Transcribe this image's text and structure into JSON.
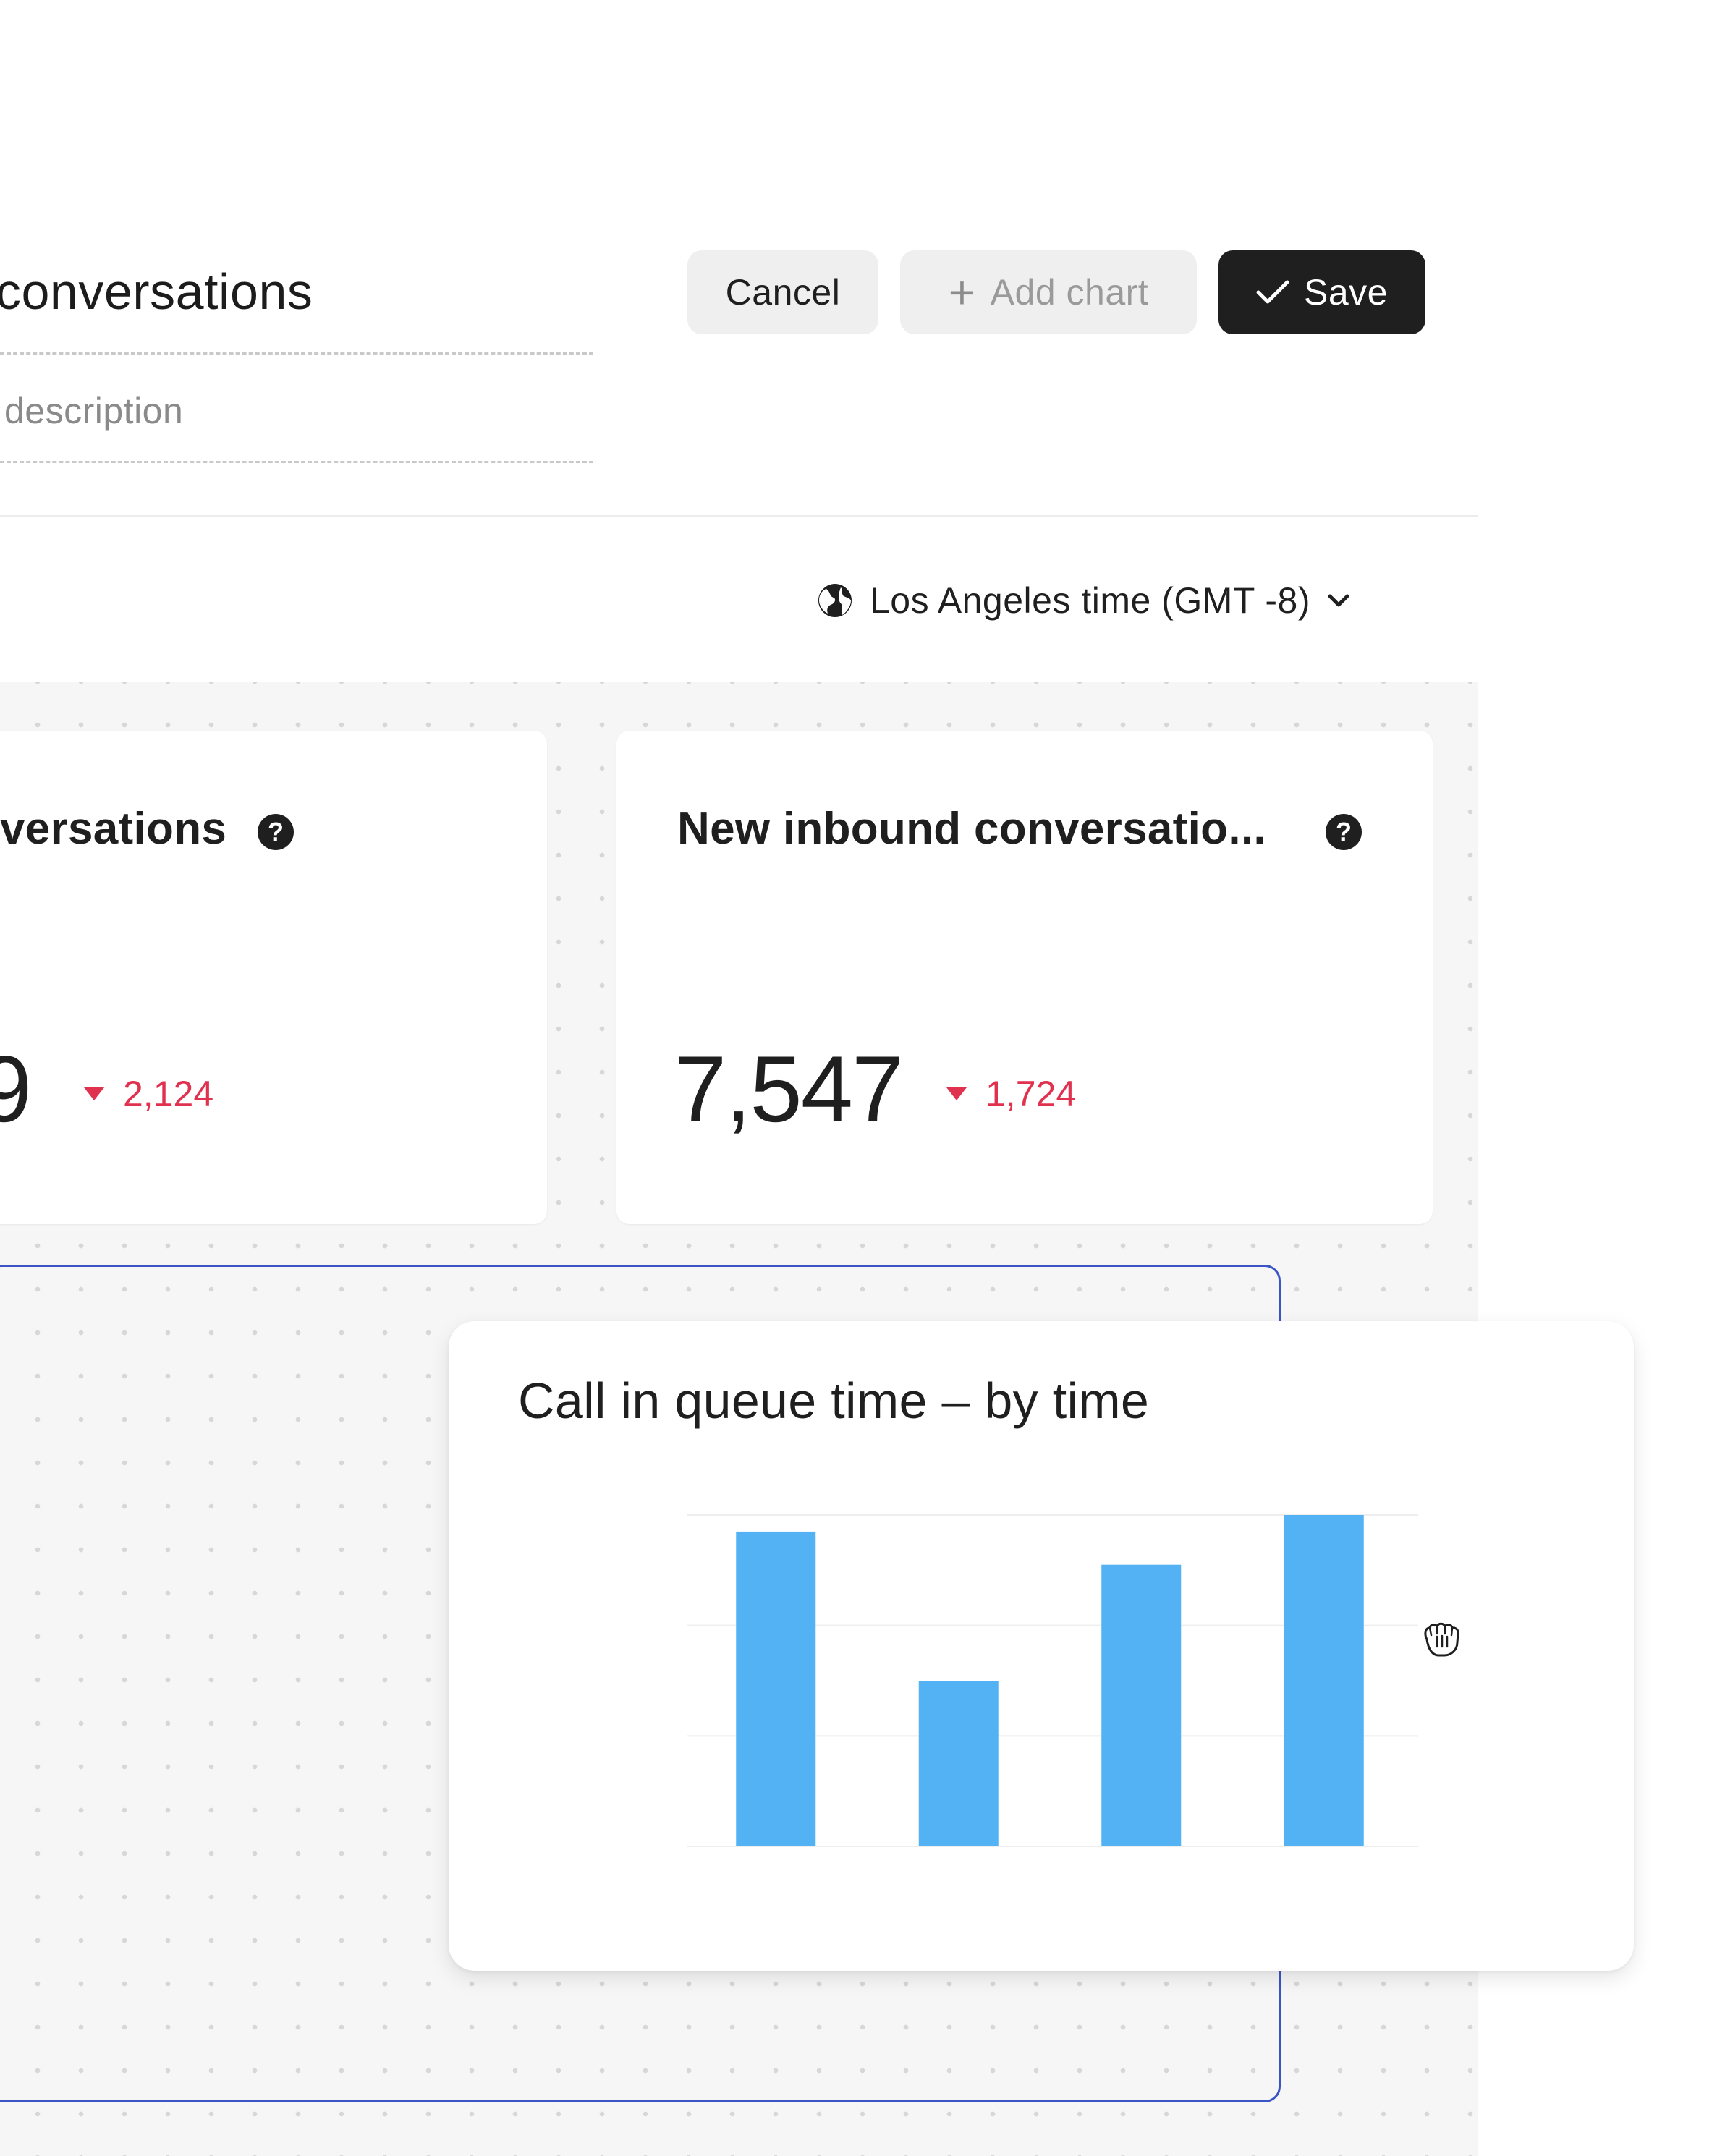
{
  "header": {
    "title_value": "conversations",
    "description_placeholder": "description",
    "cancel_label": "Cancel",
    "add_chart_label": "Add chart",
    "save_label": "Save"
  },
  "timezone": {
    "icon": "globe-icon",
    "label": "Los Angeles time (GMT -8)",
    "dropdown_icon": "chevron-down-icon"
  },
  "cards": [
    {
      "title": "versations",
      "value": "9",
      "delta": "2,124",
      "delta_direction": "down"
    },
    {
      "title": "New inbound conversatio...",
      "value": "7,547",
      "delta": "1,724",
      "delta_direction": "down"
    }
  ],
  "chart_card": {
    "title": "Call in queue time – by time"
  },
  "chart_data": {
    "type": "bar",
    "title": "Call in queue time – by time",
    "categories": [
      "",
      "",
      "",
      ""
    ],
    "values": [
      95,
      50,
      85,
      100
    ],
    "ylim": [
      0,
      100
    ],
    "grid": true,
    "bar_color": "#52b2f3"
  },
  "colors": {
    "accent_dark": "#1f1f1f",
    "negative": "#e0324f",
    "selection_border": "#3b54c6",
    "bar": "#52b2f3"
  },
  "cursor": {
    "icon": "grab-hand-icon"
  }
}
